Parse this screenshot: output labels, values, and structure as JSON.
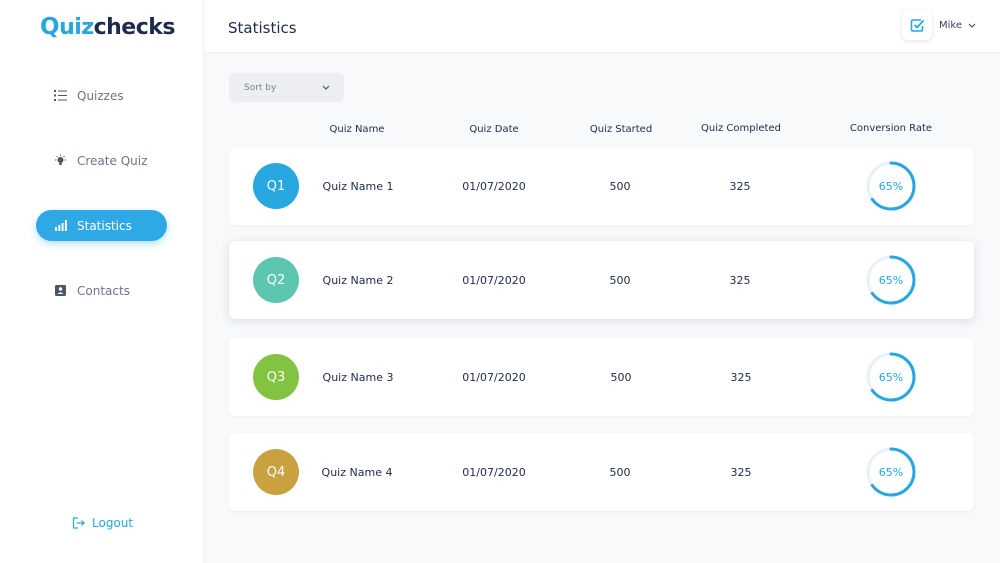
{
  "brand": {
    "logo_q": "Q",
    "logo_uiz": "uiz",
    "logo_checks": "checks",
    "accent": "#27a6e0"
  },
  "sidebar": {
    "items": [
      {
        "label": "Quizzes",
        "icon": "list-icon",
        "active": false
      },
      {
        "label": "Create Quiz",
        "icon": "lightbulb-icon",
        "active": false
      },
      {
        "label": "Statistics",
        "icon": "bar-chart-icon",
        "active": true
      },
      {
        "label": "Contacts",
        "icon": "contact-card-icon",
        "active": false
      }
    ],
    "logout_label": "Logout"
  },
  "header": {
    "title": "Statistics",
    "user_name": "Mike",
    "user_icon": "check-square-icon"
  },
  "sort": {
    "label": "Sort by"
  },
  "table": {
    "columns": [
      "Quiz Name",
      "Quiz Date",
      "Quiz Started",
      "Quiz Completed",
      "Conversion Rate"
    ],
    "rows": [
      {
        "badge": "Q1",
        "badge_color": "#27a6e0",
        "name": "Quiz Name 1",
        "date": "01/07/2020",
        "started": "500",
        "completed": "325",
        "rate_label": "65%",
        "rate": 0.65
      },
      {
        "badge": "Q2",
        "badge_color": "#5cc6ae",
        "name": "Quiz Name 2",
        "date": "01/07/2020",
        "started": "500",
        "completed": "325",
        "rate_label": "65%",
        "rate": 0.65
      },
      {
        "badge": "Q3",
        "badge_color": "#82c341",
        "name": "Quiz Name 3",
        "date": "01/07/2020",
        "started": "500",
        "completed": "325",
        "rate_label": "65%",
        "rate": 0.65
      },
      {
        "badge": "Q4",
        "badge_color": "#c9a141",
        "name": "Quiz Name 4",
        "date": "01/07/2020",
        "started": "500",
        "completed": "325",
        "rate_label": "65%",
        "rate": 0.65
      }
    ]
  }
}
